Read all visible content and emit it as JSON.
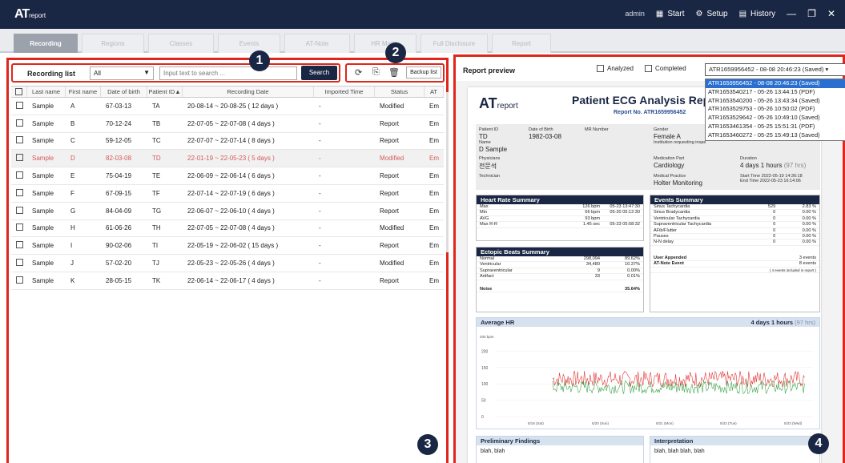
{
  "app": {
    "logo_main": "AT",
    "logo_sub": "report",
    "user": "admin",
    "start_label": "Start",
    "setup_label": "Setup",
    "history_label": "History",
    "minimize": "—",
    "maximize": "❐",
    "close": "✕"
  },
  "tabs": [
    "Recording",
    "Regions",
    "Classes",
    "Events",
    "AT-Note",
    "HR Matrix",
    "Full Disclosure",
    "Report"
  ],
  "recording_list": {
    "label": "Recording list",
    "filter_value": "All",
    "search_placeholder": "Input text to search ...",
    "search_button": "Search",
    "backup_button": "Backup list",
    "columns": [
      "",
      "Last name",
      "First name",
      "Date of birth",
      "Patient ID▲",
      "Recording Date",
      "Imported Time",
      "Status",
      "AT"
    ],
    "rows": [
      {
        "last": "Sample",
        "first": "A",
        "dob": "67-03-13",
        "pid": "TA",
        "date": "20-08-14 ~ 20-08-25 ( 12 days )",
        "imported": "-",
        "status": "Modified",
        "at": "Em"
      },
      {
        "last": "Sample",
        "first": "B",
        "dob": "70-12-24",
        "pid": "TB",
        "date": "22-07-05 ~ 22-07-08 ( 4 days )",
        "imported": "-",
        "status": "Report",
        "at": "Em"
      },
      {
        "last": "Sample",
        "first": "C",
        "dob": "59-12-05",
        "pid": "TC",
        "date": "22-07-07 ~ 22-07-14 ( 8 days )",
        "imported": "-",
        "status": "Report",
        "at": "Em"
      },
      {
        "last": "Sample",
        "first": "D",
        "dob": "82-03-08",
        "pid": "TD",
        "date": "22-01-19 ~ 22-05-23 ( 5 days )",
        "imported": "-",
        "status": "Modified",
        "at": "Em"
      },
      {
        "last": "Sample",
        "first": "E",
        "dob": "75-04-19",
        "pid": "TE",
        "date": "22-06-09 ~ 22-06-14 ( 6 days )",
        "imported": "-",
        "status": "Report",
        "at": "Em"
      },
      {
        "last": "Sample",
        "first": "F",
        "dob": "67-09-15",
        "pid": "TF",
        "date": "22-07-14 ~ 22-07-19 ( 6 days )",
        "imported": "-",
        "status": "Report",
        "at": "Em"
      },
      {
        "last": "Sample",
        "first": "G",
        "dob": "84-04-09",
        "pid": "TG",
        "date": "22-06-07 ~ 22-06-10 ( 4 days )",
        "imported": "-",
        "status": "Report",
        "at": "Em"
      },
      {
        "last": "Sample",
        "first": "H",
        "dob": "61-06-26",
        "pid": "TH",
        "date": "22-07-05 ~ 22-07-08 ( 4 days )",
        "imported": "-",
        "status": "Modified",
        "at": "Em"
      },
      {
        "last": "Sample",
        "first": "I",
        "dob": "90-02-06",
        "pid": "TI",
        "date": "22-05-19 ~ 22-06-02 ( 15 days )",
        "imported": "-",
        "status": "Report",
        "at": "Em"
      },
      {
        "last": "Sample",
        "first": "J",
        "dob": "57-02-20",
        "pid": "TJ",
        "date": "22-05-23 ~ 22-05-26 ( 4 days )",
        "imported": "-",
        "status": "Modified",
        "at": "Em"
      },
      {
        "last": "Sample",
        "first": "K",
        "dob": "28-05-15",
        "pid": "TK",
        "date": "22-06-14 ~ 22-06-17 ( 4 days )",
        "imported": "-",
        "status": "Report",
        "at": "Em"
      }
    ],
    "selected_index": 3
  },
  "badges": [
    "1",
    "2",
    "3",
    "4"
  ],
  "report_preview": {
    "label": "Report preview",
    "analyzed_label": "Analyzed",
    "completed_label": "Completed",
    "selected_report": "ATR1659956452 - 08-08 20:46:23 (Saved)",
    "report_options": [
      "ATR1659956452 - 08-08 20:46:23 (Saved)",
      "ATR1653540217 - 05-26 13:44:15 (PDF)",
      "ATR1653540200 - 05-26 13:43:34 (Saved)",
      "ATR1653529753 - 05-26 10:50:02 (PDF)",
      "ATR1653529642 - 05-26 10:49:10 (Saved)",
      "ATR1653461354 - 05-25 15:51:31 (PDF)",
      "ATR1653460272 - 05-25 15:49:13 (Saved)"
    ],
    "doc": {
      "logo_main": "AT",
      "logo_sub": "report",
      "title": "Patient ECG Analysis Rep",
      "report_no": "Report No. ATR1659956452",
      "patient_id_label": "Patient ID",
      "patient_id": "TD",
      "dob_label": "Date of Birth",
      "dob": "1982-03-08",
      "mr_label": "MR Number",
      "mr": "",
      "gender_label": "Gender",
      "gender": "Female",
      "gender_extra": "A",
      "name_label": "Name",
      "name": "D Sample",
      "institution_label": "Institution requesting inspe",
      "physician_label": "Physicians",
      "physician": "전문석",
      "med_part_label": "Medication Part",
      "med_part": "Cardiology",
      "duration_label": "Duration",
      "duration": "4 days 1 hours",
      "duration_hrs": "(97 hrs)",
      "start_label": "Start Time",
      "start": "2022-05-19 14:36:18",
      "end_label": "End Time",
      "end": "2022-05-23 16:14:06",
      "technician_label": "Technician",
      "medical_practice_label": "Medical Practice",
      "medical_practice": "Holter Monitoring",
      "hr_summary": {
        "title": "Heart Rate Summary",
        "rows": [
          {
            "k": "Max",
            "v": "126 bpm",
            "t": "05-23 13:47:30"
          },
          {
            "k": "Min",
            "v": "66 bpm",
            "t": "05-20 05:12:30"
          },
          {
            "k": "AVG",
            "v": "93 bpm",
            "t": ""
          },
          {
            "k": "Max R-R",
            "v": "1.45 sec",
            "t": "05-23 05:58:32"
          }
        ]
      },
      "ectopic": {
        "title": "Ectopic Beats Summary",
        "rows": [
          {
            "k": "Normal",
            "v": "298,094",
            "p": "89.62%"
          },
          {
            "k": "Ventricular",
            "v": "34,480",
            "p": "10.37%"
          },
          {
            "k": "Supraventricular",
            "v": "9",
            "p": "0.00%"
          },
          {
            "k": "Artifact",
            "v": "33",
            "p": "0.01%"
          }
        ],
        "noise_label": "Noise",
        "noise_value": "35.64%"
      },
      "events": {
        "title": "Events Summary",
        "rows": [
          {
            "k": "Sinus Tachycardia",
            "v": "529",
            "p": "2.83 %"
          },
          {
            "k": "Sinus Bradycardia",
            "v": "0",
            "p": "0.00 %"
          },
          {
            "k": "Ventricular Tachycardia",
            "v": "0",
            "p": "0.00 %"
          },
          {
            "k": "Supraventricular Tachycardia",
            "v": "0",
            "p": "0.00 %"
          },
          {
            "k": "AFib/Flutter",
            "v": "0",
            "p": "0.00 %"
          },
          {
            "k": "Pauses",
            "v": "0",
            "p": "0.00 %"
          },
          {
            "k": "N-N delay",
            "v": "0",
            "p": "0.00 %"
          }
        ],
        "user_appended_label": "User Appended",
        "user_appended_value": "3 events",
        "at_note_label": "AT-Note Event",
        "at_note_value": "8 events",
        "note": "( 4 events included in report )"
      },
      "avg_hr_title": "Average HR",
      "avg_hr_duration": "4 days 1 hours",
      "avg_hr_hrs": "(97 hrs)",
      "findings_title": "Preliminary Findings",
      "findings_text": "blah, blah",
      "interp_title": "Interpretation",
      "interp_text": "blah, blah blah, blah"
    }
  },
  "chart_data": {
    "type": "line",
    "ylabel": "200 bpm",
    "yticks": [
      200,
      150,
      100,
      50,
      0
    ],
    "ylim": [
      0,
      250
    ],
    "xticks": [
      "5/19 (Sat)",
      "5/20 (Sun)",
      "5/21 (Mon)",
      "5/22 (Tue)",
      "5/23 (Wed)"
    ],
    "series": [
      {
        "color": "#e02020",
        "approx_range": [
          90,
          140
        ]
      },
      {
        "color": "#2a9a3a",
        "approx_range": [
          70,
          110
        ]
      }
    ]
  }
}
